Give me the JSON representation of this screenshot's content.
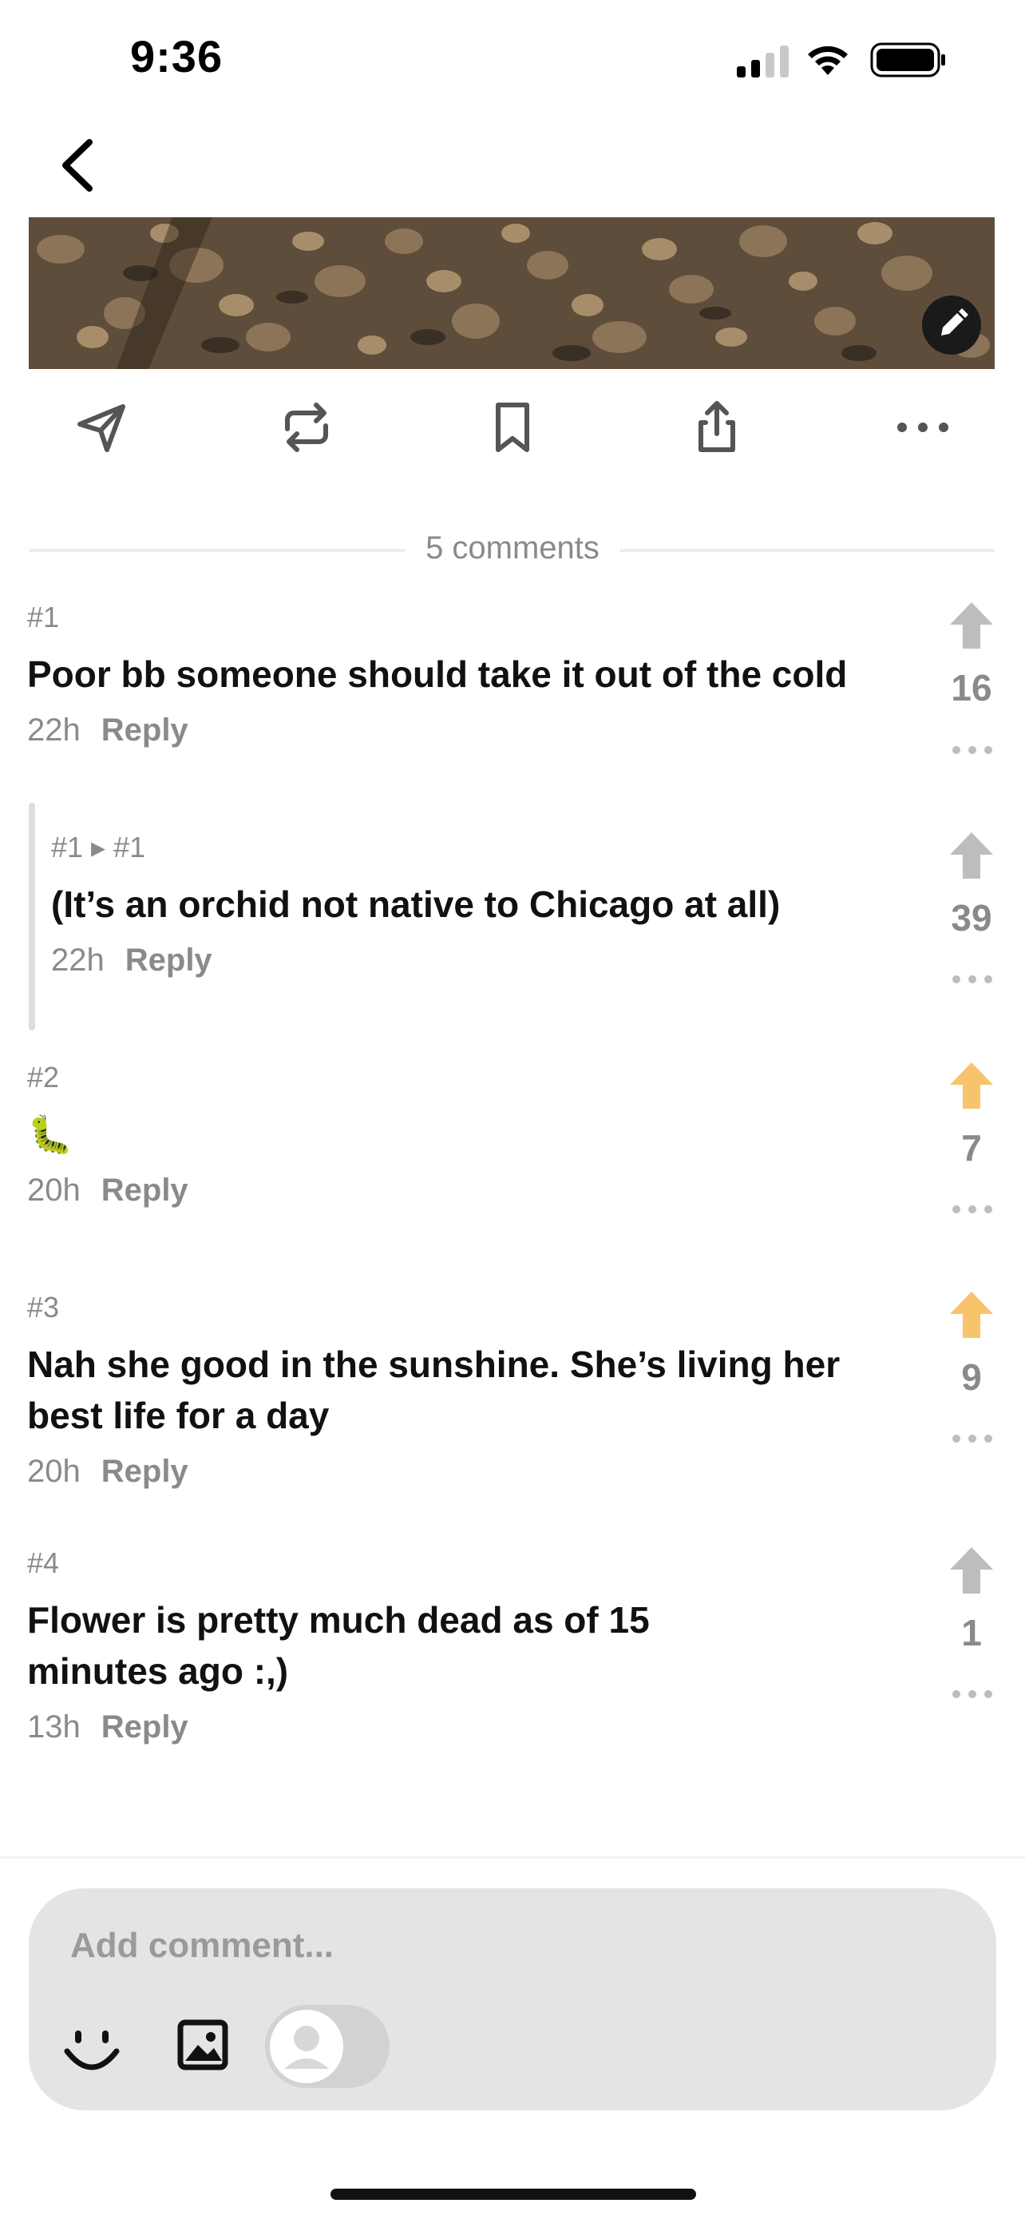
{
  "status_bar": {
    "time": "9:36"
  },
  "comments_header": {
    "label": "5 comments"
  },
  "comments": [
    {
      "number": "#1",
      "text": "Poor bb someone should take it out of the cold",
      "age": "22h",
      "reply_label": "Reply",
      "votes": "16",
      "upvoted": false
    },
    {
      "number": "#1 ▸ #1",
      "text": "(It’s an orchid not native to Chicago at all)",
      "age": "22h",
      "reply_label": "Reply",
      "votes": "39",
      "upvoted": false
    },
    {
      "number": "#2",
      "text": "🐛",
      "age": "20h",
      "reply_label": "Reply",
      "votes": "7",
      "upvoted": true
    },
    {
      "number": "#3",
      "text": "Nah she good in the sunshine. She’s living her best life for a day",
      "age": "20h",
      "reply_label": "Reply",
      "votes": "9",
      "upvoted": true
    },
    {
      "number": "#4",
      "text": "Flower is pretty much dead as of 15 minutes ago :,)",
      "age": "13h",
      "reply_label": "Reply",
      "votes": "1",
      "upvoted": false
    }
  ],
  "composer": {
    "placeholder": "Add comment..."
  },
  "icons": {
    "back": "chevron-left-icon",
    "edit": "pencil-icon",
    "send": "paper-plane-icon",
    "repost": "repost-icon",
    "bookmark": "bookmark-icon",
    "share": "share-icon",
    "more": "more-horizontal-icon",
    "upvote": "arrow-up-icon",
    "emoji": "smiley-icon",
    "image": "image-icon",
    "anonymous": "avatar-toggle-icon"
  },
  "colors": {
    "upvoted": "#F7C46C",
    "neutral_vote": "#BDBDBD",
    "muted_text": "#8A8A8A",
    "composer_bg": "#E4E4E4"
  }
}
